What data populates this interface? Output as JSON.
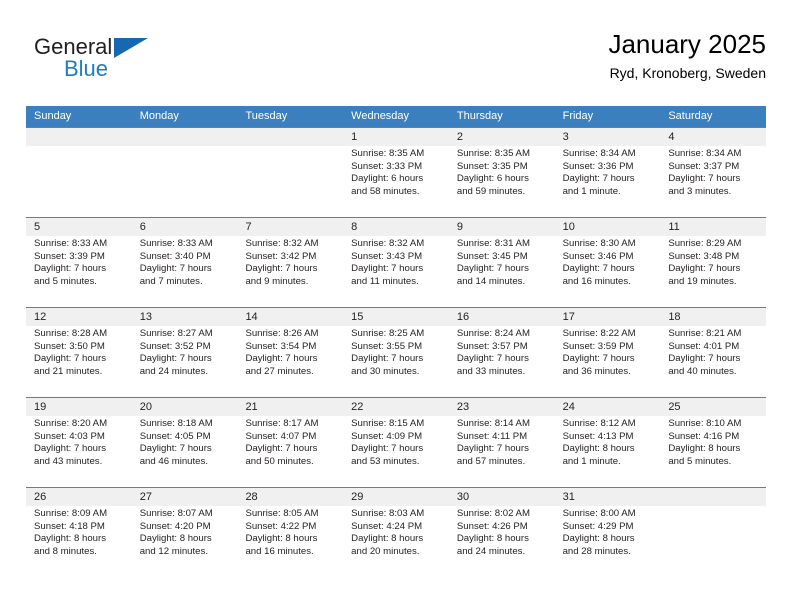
{
  "brand": {
    "word_one": "General",
    "word_two": "Blue",
    "triangle_color": "#1668b3",
    "blue_text_color": "#1e7cc4"
  },
  "header": {
    "title": "January 2025",
    "subtitle": "Ryd, Kronoberg, Sweden"
  },
  "theme": {
    "header_row_bg": "#3c7fbe",
    "header_row_text": "#ffffff",
    "week_separator": "#4a86bd",
    "date_band_bg": "#f0f0f0",
    "cell_bg": "#ffffff",
    "text": "#231f20"
  },
  "day_names": [
    "Sunday",
    "Monday",
    "Tuesday",
    "Wednesday",
    "Thursday",
    "Friday",
    "Saturday"
  ],
  "labels": {
    "sunrise": "Sunrise:",
    "sunset": "Sunset:",
    "daylight": "Daylight:"
  },
  "weeks": [
    [
      {
        "date": "",
        "lines": []
      },
      {
        "date": "",
        "lines": []
      },
      {
        "date": "",
        "lines": []
      },
      {
        "date": "1",
        "lines": [
          "Sunrise: 8:35 AM",
          "Sunset: 3:33 PM",
          "Daylight: 6 hours",
          "and 58 minutes."
        ]
      },
      {
        "date": "2",
        "lines": [
          "Sunrise: 8:35 AM",
          "Sunset: 3:35 PM",
          "Daylight: 6 hours",
          "and 59 minutes."
        ]
      },
      {
        "date": "3",
        "lines": [
          "Sunrise: 8:34 AM",
          "Sunset: 3:36 PM",
          "Daylight: 7 hours",
          "and 1 minute."
        ]
      },
      {
        "date": "4",
        "lines": [
          "Sunrise: 8:34 AM",
          "Sunset: 3:37 PM",
          "Daylight: 7 hours",
          "and 3 minutes."
        ]
      }
    ],
    [
      {
        "date": "5",
        "lines": [
          "Sunrise: 8:33 AM",
          "Sunset: 3:39 PM",
          "Daylight: 7 hours",
          "and 5 minutes."
        ]
      },
      {
        "date": "6",
        "lines": [
          "Sunrise: 8:33 AM",
          "Sunset: 3:40 PM",
          "Daylight: 7 hours",
          "and 7 minutes."
        ]
      },
      {
        "date": "7",
        "lines": [
          "Sunrise: 8:32 AM",
          "Sunset: 3:42 PM",
          "Daylight: 7 hours",
          "and 9 minutes."
        ]
      },
      {
        "date": "8",
        "lines": [
          "Sunrise: 8:32 AM",
          "Sunset: 3:43 PM",
          "Daylight: 7 hours",
          "and 11 minutes."
        ]
      },
      {
        "date": "9",
        "lines": [
          "Sunrise: 8:31 AM",
          "Sunset: 3:45 PM",
          "Daylight: 7 hours",
          "and 14 minutes."
        ]
      },
      {
        "date": "10",
        "lines": [
          "Sunrise: 8:30 AM",
          "Sunset: 3:46 PM",
          "Daylight: 7 hours",
          "and 16 minutes."
        ]
      },
      {
        "date": "11",
        "lines": [
          "Sunrise: 8:29 AM",
          "Sunset: 3:48 PM",
          "Daylight: 7 hours",
          "and 19 minutes."
        ]
      }
    ],
    [
      {
        "date": "12",
        "lines": [
          "Sunrise: 8:28 AM",
          "Sunset: 3:50 PM",
          "Daylight: 7 hours",
          "and 21 minutes."
        ]
      },
      {
        "date": "13",
        "lines": [
          "Sunrise: 8:27 AM",
          "Sunset: 3:52 PM",
          "Daylight: 7 hours",
          "and 24 minutes."
        ]
      },
      {
        "date": "14",
        "lines": [
          "Sunrise: 8:26 AM",
          "Sunset: 3:54 PM",
          "Daylight: 7 hours",
          "and 27 minutes."
        ]
      },
      {
        "date": "15",
        "lines": [
          "Sunrise: 8:25 AM",
          "Sunset: 3:55 PM",
          "Daylight: 7 hours",
          "and 30 minutes."
        ]
      },
      {
        "date": "16",
        "lines": [
          "Sunrise: 8:24 AM",
          "Sunset: 3:57 PM",
          "Daylight: 7 hours",
          "and 33 minutes."
        ]
      },
      {
        "date": "17",
        "lines": [
          "Sunrise: 8:22 AM",
          "Sunset: 3:59 PM",
          "Daylight: 7 hours",
          "and 36 minutes."
        ]
      },
      {
        "date": "18",
        "lines": [
          "Sunrise: 8:21 AM",
          "Sunset: 4:01 PM",
          "Daylight: 7 hours",
          "and 40 minutes."
        ]
      }
    ],
    [
      {
        "date": "19",
        "lines": [
          "Sunrise: 8:20 AM",
          "Sunset: 4:03 PM",
          "Daylight: 7 hours",
          "and 43 minutes."
        ]
      },
      {
        "date": "20",
        "lines": [
          "Sunrise: 8:18 AM",
          "Sunset: 4:05 PM",
          "Daylight: 7 hours",
          "and 46 minutes."
        ]
      },
      {
        "date": "21",
        "lines": [
          "Sunrise: 8:17 AM",
          "Sunset: 4:07 PM",
          "Daylight: 7 hours",
          "and 50 minutes."
        ]
      },
      {
        "date": "22",
        "lines": [
          "Sunrise: 8:15 AM",
          "Sunset: 4:09 PM",
          "Daylight: 7 hours",
          "and 53 minutes."
        ]
      },
      {
        "date": "23",
        "lines": [
          "Sunrise: 8:14 AM",
          "Sunset: 4:11 PM",
          "Daylight: 7 hours",
          "and 57 minutes."
        ]
      },
      {
        "date": "24",
        "lines": [
          "Sunrise: 8:12 AM",
          "Sunset: 4:13 PM",
          "Daylight: 8 hours",
          "and 1 minute."
        ]
      },
      {
        "date": "25",
        "lines": [
          "Sunrise: 8:10 AM",
          "Sunset: 4:16 PM",
          "Daylight: 8 hours",
          "and 5 minutes."
        ]
      }
    ],
    [
      {
        "date": "26",
        "lines": [
          "Sunrise: 8:09 AM",
          "Sunset: 4:18 PM",
          "Daylight: 8 hours",
          "and 8 minutes."
        ]
      },
      {
        "date": "27",
        "lines": [
          "Sunrise: 8:07 AM",
          "Sunset: 4:20 PM",
          "Daylight: 8 hours",
          "and 12 minutes."
        ]
      },
      {
        "date": "28",
        "lines": [
          "Sunrise: 8:05 AM",
          "Sunset: 4:22 PM",
          "Daylight: 8 hours",
          "and 16 minutes."
        ]
      },
      {
        "date": "29",
        "lines": [
          "Sunrise: 8:03 AM",
          "Sunset: 4:24 PM",
          "Daylight: 8 hours",
          "and 20 minutes."
        ]
      },
      {
        "date": "30",
        "lines": [
          "Sunrise: 8:02 AM",
          "Sunset: 4:26 PM",
          "Daylight: 8 hours",
          "and 24 minutes."
        ]
      },
      {
        "date": "31",
        "lines": [
          "Sunrise: 8:00 AM",
          "Sunset: 4:29 PM",
          "Daylight: 8 hours",
          "and 28 minutes."
        ]
      },
      {
        "date": "",
        "lines": []
      }
    ]
  ]
}
